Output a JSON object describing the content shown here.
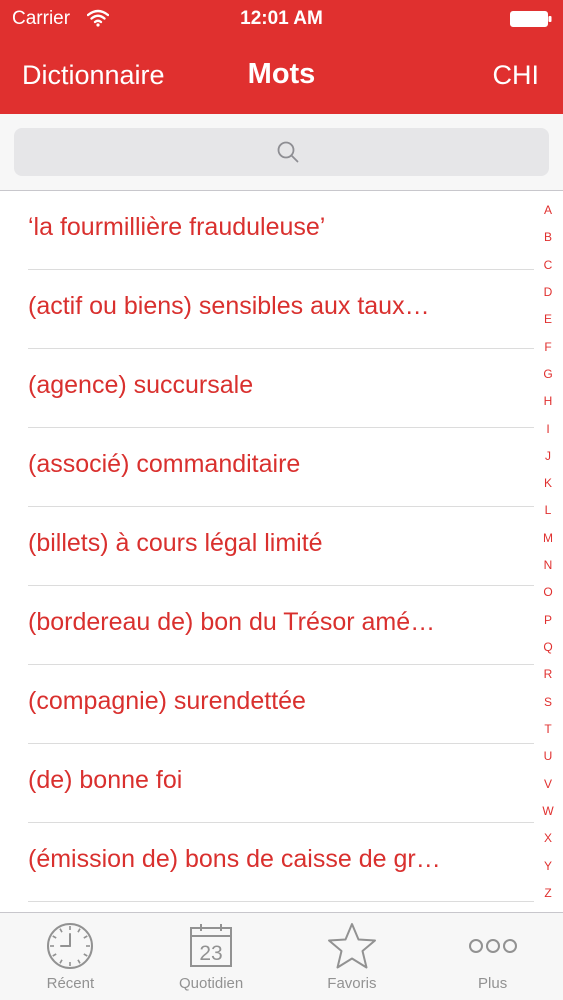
{
  "status_bar": {
    "carrier": "Carrier",
    "time": "12:01 AM"
  },
  "nav": {
    "back_label": "Dictionnaire",
    "title": "Mots",
    "right_label": "CHI"
  },
  "search": {
    "placeholder": ""
  },
  "list": {
    "items": [
      "‘la fourmillière frauduleuse’",
      "(actif ou biens) sensibles aux taux…",
      "(agence) succursale",
      "(associé) commanditaire",
      "(billets) à cours légal limité",
      "(bordereau de) bon du Trésor amé…",
      "(compagnie) surendettée",
      "(de) bonne foi",
      "(émission de) bons de caisse de gr…"
    ]
  },
  "alpha_index": [
    "A",
    "B",
    "C",
    "D",
    "E",
    "F",
    "G",
    "H",
    "I",
    "J",
    "K",
    "L",
    "M",
    "N",
    "O",
    "P",
    "Q",
    "R",
    "S",
    "T",
    "U",
    "V",
    "W",
    "X",
    "Y",
    "Z"
  ],
  "tab_bar": {
    "tabs": [
      {
        "label": "Récent",
        "icon": "clock-icon"
      },
      {
        "label": "Quotidien",
        "icon": "calendar-icon",
        "day": "23"
      },
      {
        "label": "Favoris",
        "icon": "star-icon"
      },
      {
        "label": "Plus",
        "icon": "more-icon"
      }
    ]
  },
  "colors": {
    "accent": "#e0302f",
    "item_text": "#d9302e",
    "tab_inactive": "#929292"
  }
}
